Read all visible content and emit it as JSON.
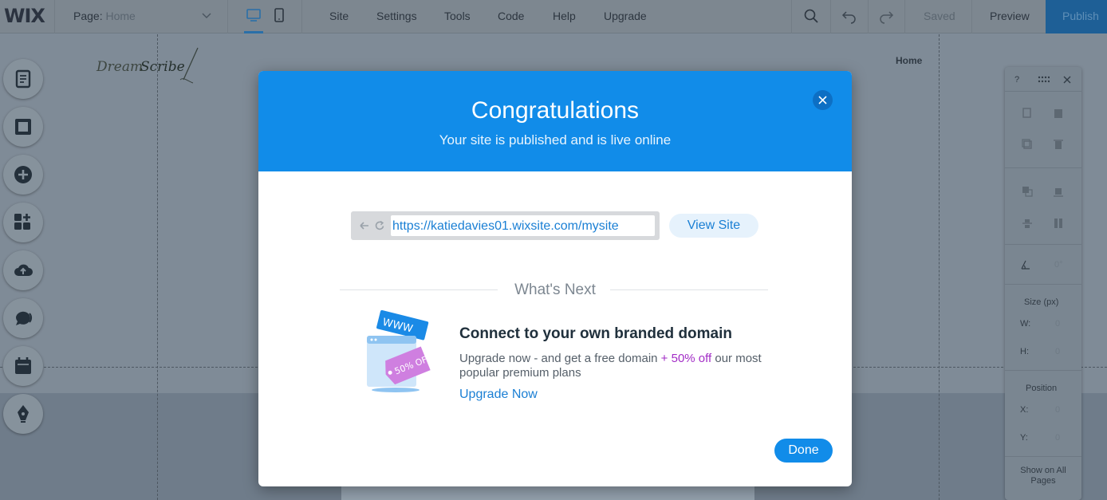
{
  "topbar": {
    "logo": "WIX",
    "page_label": "Page:",
    "page_value": "Home",
    "menu": [
      "Site",
      "Settings",
      "Tools",
      "Code",
      "Help",
      "Upgrade"
    ],
    "saved_label": "Saved",
    "preview_label": "Preview",
    "publish_label": "Publish"
  },
  "site": {
    "logo_text_1": "Dream",
    "logo_text_2": "Scribe",
    "nav_home": "Home"
  },
  "left_tools": [
    "pages-icon",
    "background-icon",
    "add-icon",
    "add-apps-icon",
    "upload-icon",
    "chat-icon",
    "bookings-icon",
    "blog-pen-icon"
  ],
  "right_panel": {
    "help": "?",
    "angle_value": "0°",
    "size_label": "Size (px)",
    "w_label": "W:",
    "w_value": "0",
    "h_label": "H:",
    "h_value": "0",
    "position_label": "Position",
    "x_label": "X:",
    "x_value": "0",
    "y_label": "Y:",
    "y_value": "0",
    "show_all_pages": "Show on All Pages"
  },
  "modal": {
    "title": "Congratulations",
    "subtitle": "Your site is published and is live online",
    "site_url": "https://katiedavies01.wixsite.com/mysite",
    "view_site_label": "View Site",
    "whats_next": "What's Next",
    "promo_art_www": "WWW",
    "promo_art_tag": "50% OFF",
    "promo_title": "Connect to your own branded domain",
    "promo_text_1": "Upgrade now - and get a free domain",
    "promo_highlight": "+ 50% off",
    "promo_text_2": "our most popular premium plans",
    "upgrade_link": "Upgrade Now",
    "done_label": "Done"
  },
  "colors": {
    "header_blue": "#118ce9",
    "link_blue": "#1a7fd4",
    "highlight_purple": "#a22cc6",
    "overlay_gray": "#7f8b97"
  }
}
